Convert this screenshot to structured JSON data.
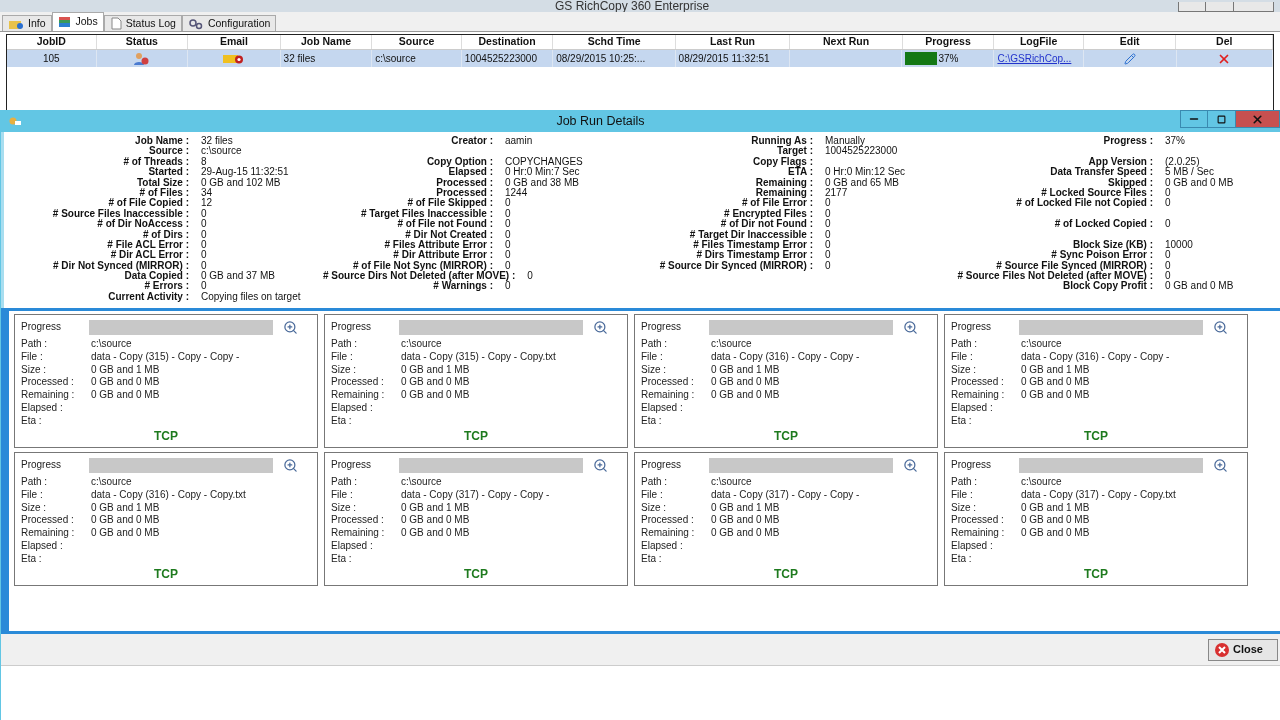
{
  "window": {
    "title": "GS RichCopy 360 Enterprise"
  },
  "tabs": [
    {
      "label": "Info",
      "selected": false
    },
    {
      "label": "Jobs",
      "selected": true
    },
    {
      "label": "Status Log",
      "selected": false
    },
    {
      "label": "Configuration",
      "selected": false
    }
  ],
  "table": {
    "columns": [
      "JobID",
      "Status",
      "Email",
      "Job Name",
      "Source",
      "Destination",
      "Schd Time",
      "Last Run",
      "Next Run",
      "Progress",
      "LogFile",
      "Edit",
      "Del"
    ],
    "rows": [
      {
        "selected": true,
        "job_id": "105",
        "job_name": "32 files",
        "source": "c:\\source",
        "destination": "1004525223000",
        "schd_time": "08/29/2015 10:25:...",
        "last_run": "08/29/2015 11:32:51",
        "progress": {
          "level": 0.37,
          "text": "37%"
        },
        "log_file": "C:\\GSRichCop..."
      }
    ]
  },
  "details_window": {
    "title": "Job Run Details",
    "columns": [
      [
        {
          "kind": "field",
          "label": "Job Name :",
          "value": "32 files"
        },
        {
          "kind": "field",
          "label": "Source :",
          "value": "c:\\source"
        },
        {
          "kind": "field",
          "label": "# of Threads :",
          "value": "8"
        },
        {
          "kind": "field",
          "label": "Started :",
          "value": "29-Aug-15 11:32:51"
        },
        {
          "kind": "field",
          "label": "Total Size :",
          "value": "0 GB and 102 MB"
        },
        {
          "kind": "field",
          "label": "# of Files :",
          "value": "34"
        },
        {
          "kind": "field",
          "label": "# of File Copied :",
          "value": "12"
        },
        {
          "kind": "field",
          "label": "# Source Files Inaccessible :",
          "value": "0"
        },
        {
          "kind": "field",
          "label": "# of Dir NoAccess :",
          "value": "0"
        },
        {
          "kind": "field",
          "label": "# of Dirs :",
          "value": "0"
        },
        {
          "kind": "field",
          "label": "# File ACL Error :",
          "value": "0"
        },
        {
          "kind": "field",
          "label": "# Dir ACL Error :",
          "value": "0"
        },
        {
          "kind": "field",
          "label": "# Dir Not Synced (MIRROR) :",
          "value": "0"
        },
        {
          "kind": "field",
          "label": "Data Copied :",
          "value": "0 GB and 37 MB"
        },
        {
          "kind": "field",
          "label": "# Errors :",
          "value": "0"
        },
        {
          "kind": "field",
          "label": "Current Activity :",
          "value": "Copying files on target"
        }
      ],
      [
        {
          "kind": "field",
          "label": "Creator :",
          "value": "aamin"
        },
        {
          "kind": "gap"
        },
        {
          "kind": "field",
          "label": "Copy Option :",
          "value": "COPYCHANGES"
        },
        {
          "kind": "field",
          "label": "Elapsed :",
          "value": "0 Hr:0 Min:7 Sec"
        },
        {
          "kind": "field",
          "label": "Processed :",
          "value": "0 GB and 38 MB"
        },
        {
          "kind": "field",
          "label": "Processed :",
          "value": "1244"
        },
        {
          "kind": "field",
          "label": "# of File Skipped :",
          "value": "0"
        },
        {
          "kind": "field",
          "label": "# Target Files Inaccessible :",
          "value": "0"
        },
        {
          "kind": "field",
          "label": "# of File not Found :",
          "value": "0"
        },
        {
          "kind": "field",
          "label": "# Dir Not Created :",
          "value": "0"
        },
        {
          "kind": "field",
          "label": "# Files Attribute Error :",
          "value": "0"
        },
        {
          "kind": "field",
          "label": "# Dir Attribute Error :",
          "value": "0"
        },
        {
          "kind": "field",
          "label": "# of File Not Sync (MIRROR) :",
          "value": "0"
        },
        {
          "kind": "field",
          "label": "# Source Dirs Not Deleted (after MOVE) :",
          "value": "0"
        },
        {
          "kind": "field",
          "label": "# Warnings :",
          "value": "0"
        }
      ],
      [
        {
          "kind": "field",
          "label": "Running As :",
          "value": "Manually"
        },
        {
          "kind": "field",
          "label": "Target :",
          "value": "1004525223000"
        },
        {
          "kind": "field",
          "label": "Copy Flags :"
        },
        {
          "kind": "field",
          "label": "ETA :",
          "value": "0 Hr:0 Min:12 Sec"
        },
        {
          "kind": "field",
          "label": "Remaining :",
          "value": "0 GB and 65 MB"
        },
        {
          "kind": "field",
          "label": "Remaining :",
          "value": "2177"
        },
        {
          "kind": "field",
          "label": "# of File Error :",
          "value": "0"
        },
        {
          "kind": "field",
          "label": "# Encrypted Files :",
          "value": "0"
        },
        {
          "kind": "field",
          "label": "# of Dir not Found :",
          "value": "0"
        },
        {
          "kind": "field",
          "label": "# Target Dir Inaccessible :",
          "value": "0"
        },
        {
          "kind": "field",
          "label": "# Files Timestamp Error :",
          "value": "0"
        },
        {
          "kind": "field",
          "label": "# Dirs Timestamp Error :",
          "value": "0"
        },
        {
          "kind": "field",
          "label": "# Source Dir Synced (MIRROR) :",
          "value": "0"
        }
      ],
      [
        {
          "kind": "field",
          "label": "Progress :",
          "value": "37%"
        },
        {
          "kind": "gap"
        },
        {
          "kind": "field",
          "label": "App Version :",
          "value": "(2.0.25)"
        },
        {
          "kind": "field",
          "label": "Data Transfer Speed :",
          "value": "5 MB / Sec"
        },
        {
          "kind": "field",
          "label": "Skipped :",
          "value": "0 GB and 0 MB"
        },
        {
          "kind": "field",
          "label": "# Locked Source Files :",
          "value": "0"
        },
        {
          "kind": "field",
          "label": "# of Locked File not Copied :",
          "value": "0"
        },
        {
          "kind": "gap"
        },
        {
          "kind": "field",
          "label": "# of Locked Copied :",
          "value": "0"
        },
        {
          "kind": "gap"
        },
        {
          "kind": "field",
          "label": "Block Size (KB) :",
          "value": "10000"
        },
        {
          "kind": "field",
          "label": "# Sync Poison Error :",
          "value": "0"
        },
        {
          "kind": "field",
          "label": "# Source File Synced (MIRROR) :",
          "value": "0"
        },
        {
          "kind": "field",
          "label": "# Source Files Not Deleted (after MOVE) :",
          "value": "0"
        },
        {
          "kind": "field",
          "label": "Block Copy Profit :",
          "value": "0 GB and 0 MB"
        }
      ]
    ],
    "threads": [
      {
        "progress_label": "Progress",
        "level": 0,
        "fields": [
          {
            "label": "Path :",
            "value": "c:\\source"
          },
          {
            "label": "File :",
            "value": "data - Copy (315) - Copy - Copy -"
          },
          {
            "label": "Size :",
            "value": "0 GB and 1 MB"
          },
          {
            "label": "Processed :",
            "value": "0 GB and 0 MB"
          },
          {
            "label": "Remaining :",
            "value": "0 GB and 0 MB"
          },
          {
            "label": "Elapsed :"
          },
          {
            "label": "Eta :"
          }
        ],
        "protocol": "TCP"
      },
      {
        "progress_label": "Progress",
        "level": 0,
        "fields": [
          {
            "label": "Path :",
            "value": "c:\\source"
          },
          {
            "label": "File :",
            "value": "data - Copy (315) - Copy - Copy.txt"
          },
          {
            "label": "Size :",
            "value": "0 GB and 1 MB"
          },
          {
            "label": "Processed :",
            "value": "0 GB and 0 MB"
          },
          {
            "label": "Remaining :",
            "value": "0 GB and 0 MB"
          },
          {
            "label": "Elapsed :"
          },
          {
            "label": "Eta :"
          }
        ],
        "protocol": "TCP"
      },
      {
        "progress_label": "Progress",
        "level": 0,
        "fields": [
          {
            "label": "Path :",
            "value": "c:\\source"
          },
          {
            "label": "File :",
            "value": "data - Copy (316) - Copy - Copy -"
          },
          {
            "label": "Size :",
            "value": "0 GB and 1 MB"
          },
          {
            "label": "Processed :",
            "value": "0 GB and 0 MB"
          },
          {
            "label": "Remaining :",
            "value": "0 GB and 0 MB"
          },
          {
            "label": "Elapsed :"
          },
          {
            "label": "Eta :"
          }
        ],
        "protocol": "TCP"
      },
      {
        "progress_label": "Progress",
        "level": 0,
        "fields": [
          {
            "label": "Path :",
            "value": "c:\\source"
          },
          {
            "label": "File :",
            "value": "data - Copy (316) - Copy - Copy -"
          },
          {
            "label": "Size :",
            "value": "0 GB and 1 MB"
          },
          {
            "label": "Processed :",
            "value": "0 GB and 0 MB"
          },
          {
            "label": "Remaining :",
            "value": "0 GB and 0 MB"
          },
          {
            "label": "Elapsed :"
          },
          {
            "label": "Eta :"
          }
        ],
        "protocol": "TCP"
      },
      {
        "progress_label": "Progress",
        "level": 0,
        "fields": [
          {
            "label": "Path :",
            "value": "c:\\source"
          },
          {
            "label": "File :",
            "value": "data - Copy (316) - Copy - Copy.txt"
          },
          {
            "label": "Size :",
            "value": "0 GB and 1 MB"
          },
          {
            "label": "Processed :",
            "value": "0 GB and 0 MB"
          },
          {
            "label": "Remaining :",
            "value": "0 GB and 0 MB"
          },
          {
            "label": "Elapsed :"
          },
          {
            "label": "Eta :"
          }
        ],
        "protocol": "TCP"
      },
      {
        "progress_label": "Progress",
        "level": 0,
        "fields": [
          {
            "label": "Path :",
            "value": "c:\\source"
          },
          {
            "label": "File :",
            "value": "data - Copy (317) - Copy - Copy -"
          },
          {
            "label": "Size :",
            "value": "0 GB and 1 MB"
          },
          {
            "label": "Processed :",
            "value": "0 GB and 0 MB"
          },
          {
            "label": "Remaining :",
            "value": "0 GB and 0 MB"
          },
          {
            "label": "Elapsed :"
          },
          {
            "label": "Eta :"
          }
        ],
        "protocol": "TCP"
      },
      {
        "progress_label": "Progress",
        "level": 0,
        "fields": [
          {
            "label": "Path :",
            "value": "c:\\source"
          },
          {
            "label": "File :",
            "value": "data - Copy (317) - Copy - Copy -"
          },
          {
            "label": "Size :",
            "value": "0 GB and 1 MB"
          },
          {
            "label": "Processed :",
            "value": "0 GB and 0 MB"
          },
          {
            "label": "Remaining :",
            "value": "0 GB and 0 MB"
          },
          {
            "label": "Elapsed :"
          },
          {
            "label": "Eta :"
          }
        ],
        "protocol": "TCP"
      },
      {
        "progress_label": "Progress",
        "level": 0,
        "fields": [
          {
            "label": "Path :",
            "value": "c:\\source"
          },
          {
            "label": "File :",
            "value": "data - Copy (317) - Copy - Copy.txt"
          },
          {
            "label": "Size :",
            "value": "0 GB and 1 MB"
          },
          {
            "label": "Processed :",
            "value": "0 GB and 0 MB"
          },
          {
            "label": "Remaining :",
            "value": "0 GB and 0 MB"
          },
          {
            "label": "Elapsed :"
          },
          {
            "label": "Eta :"
          }
        ],
        "protocol": "TCP"
      }
    ],
    "close_button": "Close"
  }
}
